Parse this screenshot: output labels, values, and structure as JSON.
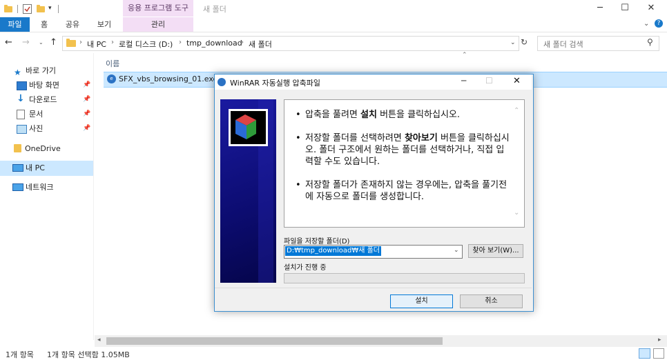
{
  "window": {
    "title": "새 폴더",
    "context_tab_group": "응용 프로그램 도구",
    "minimize_glyph": "─",
    "maximize_glyph": "☐",
    "close_glyph": "✕"
  },
  "ribbon": {
    "tabs": [
      {
        "label": "파일",
        "active": true
      },
      {
        "label": "홈"
      },
      {
        "label": "공유"
      },
      {
        "label": "보기"
      },
      {
        "label": "관리"
      }
    ]
  },
  "address": {
    "breadcrumbs": [
      "내 PC",
      "로컬 디스크 (D:)",
      "tmp_download",
      "새 폴더"
    ],
    "search_placeholder": "새 폴더 검색"
  },
  "nav": {
    "quick_access": "바로 가기",
    "items": [
      {
        "label": "바탕 화면",
        "icon": "desktop-icon"
      },
      {
        "label": "다운로드",
        "icon": "download-icon"
      },
      {
        "label": "문서",
        "icon": "documents-icon"
      },
      {
        "label": "사진",
        "icon": "pictures-icon"
      }
    ],
    "onedrive": "OneDrive",
    "this_pc": "내 PC",
    "network": "네트워크"
  },
  "file_list": {
    "column_name": "이름",
    "files": [
      {
        "name": "SFX_vbs_browsing_01.exe"
      }
    ]
  },
  "status": {
    "item_count": "1개 항목",
    "selection": "1개 항목 선택함 1.05MB"
  },
  "dialog": {
    "title": "WinRAR 자동실행 압축파일",
    "bullets": [
      {
        "pre": "압축을 풀려면 ",
        "bold": "설치",
        "post": " 버튼을 클릭하십시오."
      },
      {
        "pre": "저장할 폴더를 선택하려면 ",
        "bold": "찾아보기",
        "post": " 버튼을 클릭하십시오. 폴더 구조에서 원하는 폴더를 선택하거나, 직접 입력할 수도 있습니다."
      },
      {
        "pre": "저장할 폴더가 존재하지 않는 경우에는, 압축을 풀기전에 자동으로 폴더를 생성합니다.",
        "bold": "",
        "post": ""
      }
    ],
    "dest_label": "파일을 저장할 폴더(D)",
    "dest_value": "D:₩tmp_download₩새 폴더",
    "browse_button": "찾아 보기(W)...",
    "progress_label": "설치가 진행 중",
    "progress": 0,
    "install_button": "설치",
    "cancel_button": "취소"
  },
  "colors": {
    "accent": "#1979ca",
    "context_tab": "#f3def5",
    "selection": "#cce8ff",
    "dialog_banner": "#0c0c70"
  }
}
